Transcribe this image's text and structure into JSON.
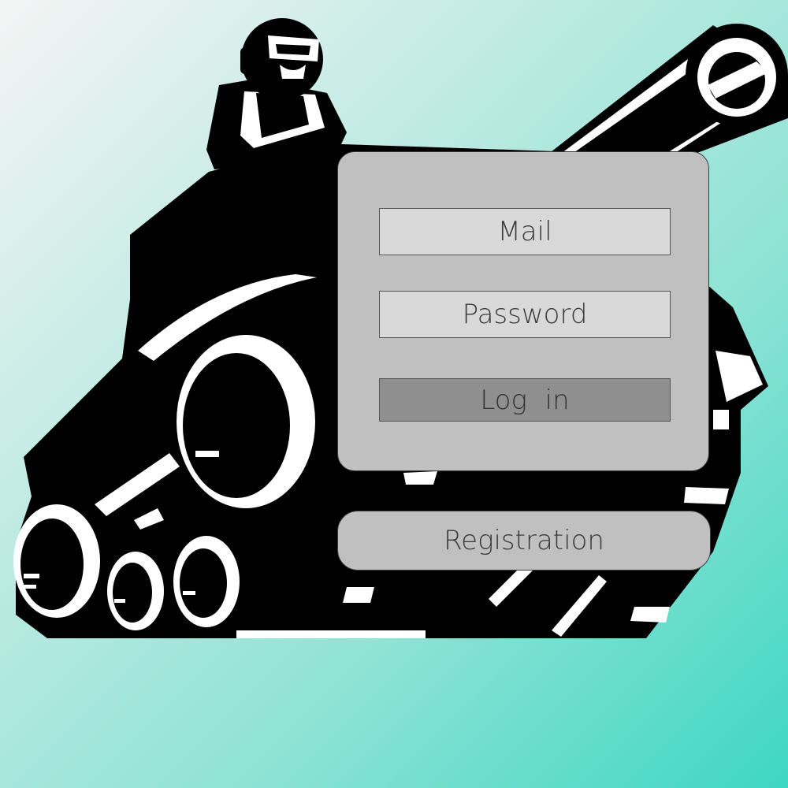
{
  "background": {
    "gradient": [
      "#f4f4f4",
      "#c9ece6",
      "#8fe3d5",
      "#3ed6c3"
    ]
  },
  "illustration": {
    "icon": "tank-mascot-icon"
  },
  "login_form": {
    "mail_placeholder": "Mail",
    "password_placeholder": "Password",
    "login_label": "Log in",
    "panel_color": "#c0c0c0",
    "field_color": "#d9d9d9",
    "button_color": "#8f8f8f"
  },
  "registration": {
    "label": "Registration"
  }
}
